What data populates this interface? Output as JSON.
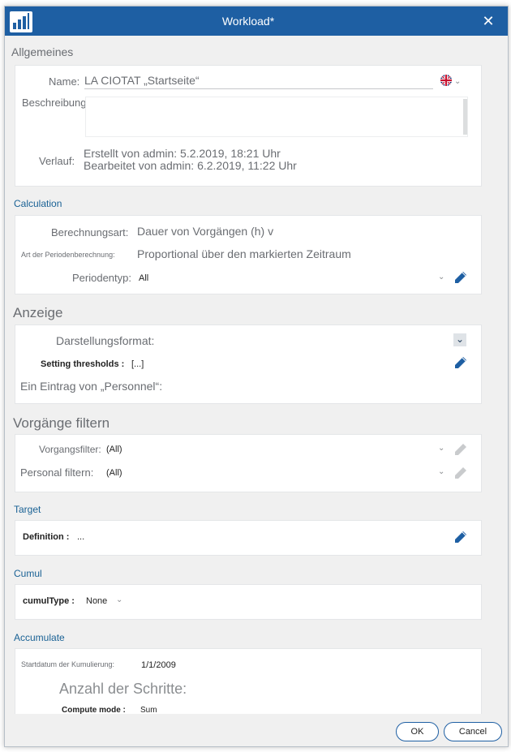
{
  "window": {
    "title": "Workload*"
  },
  "general": {
    "header": "Allgemeines",
    "name_label": "Name:",
    "name_value": "LA CIOTAT „Startseite“",
    "description_label": "Beschreibung:",
    "history_label": "Verlauf:",
    "created": "Erstellt von admin: 5.2.2019, 18:21 Uhr",
    "edited": "Bearbeitet von admin: 6.2.2019, 11:22 Uhr"
  },
  "calculation": {
    "header": "Calculation",
    "calc_type_label": "Berechnungsart:",
    "calc_type_value": "Dauer von Vorgängen (h) v",
    "period_calc_label": "Art der Periodenberechnung:",
    "period_calc_value": "Proportional über den markierten Zeitraum",
    "period_type_label": "Periodentyp:",
    "period_type_value": "All"
  },
  "display": {
    "header": "Anzeige",
    "format_label": "Darstellungsformat:",
    "thresholds_label": "Setting thresholds :",
    "thresholds_value": "[...]",
    "entry_label": "Ein Eintrag von „Personnel“:"
  },
  "filter": {
    "header": "Vorgänge filtern",
    "task_filter_label": "Vorgangsfilter:",
    "task_filter_value": "(All)",
    "staff_filter_label": "Personal filtern:",
    "staff_filter_value": "(All)"
  },
  "target": {
    "header": "Target",
    "definition_label": "Definition :",
    "definition_value": "..."
  },
  "cumul": {
    "header": "Cumul",
    "type_label": "cumulType :",
    "type_value": "None"
  },
  "accumulate": {
    "header": "Accumulate",
    "start_label": "Startdatum der Kumulierung:",
    "start_value": "1/1/2009",
    "steps_label": "Anzahl der Schritte:",
    "mode_label": "Compute mode :",
    "mode_value": "Sum"
  },
  "buttons": {
    "ok": "OK",
    "cancel": "Cancel"
  },
  "colors": {
    "titlebar": "#1e5fa3",
    "accent": "#1a6295",
    "pencil": "#1e5fa3"
  }
}
